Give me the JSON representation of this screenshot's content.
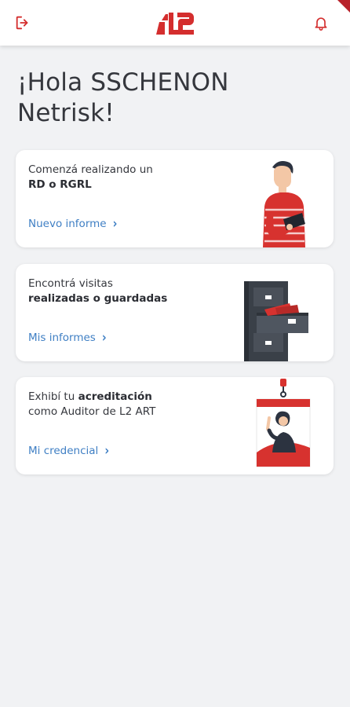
{
  "colors": {
    "brand_red": "#d42e2e",
    "link_blue": "#3f7fc4",
    "background": "#f1f2f4"
  },
  "header": {
    "logo_text": "L2",
    "logout_icon": "logout-icon",
    "bell_icon": "bell-icon"
  },
  "greeting": "¡Hola SSCHENON Netrisk!",
  "cards": [
    {
      "line1": "Comenzá realizando un",
      "line1_bold": "",
      "line2_bold": "RD o RGRL",
      "line2": "",
      "link": "Nuevo informe",
      "illustration": "person-with-tablet"
    },
    {
      "line1": "Encontrá visitas",
      "line1_bold": "",
      "line2_bold": "realizadas o guardadas",
      "line2": "",
      "link": "Mis informes",
      "illustration": "file-cabinet"
    },
    {
      "line1": "Exhibí tu ",
      "line1_bold": "acreditación",
      "line2_bold": "",
      "line2": "como Auditor de L2 ART",
      "link": "Mi credencial",
      "illustration": "id-badge"
    }
  ]
}
